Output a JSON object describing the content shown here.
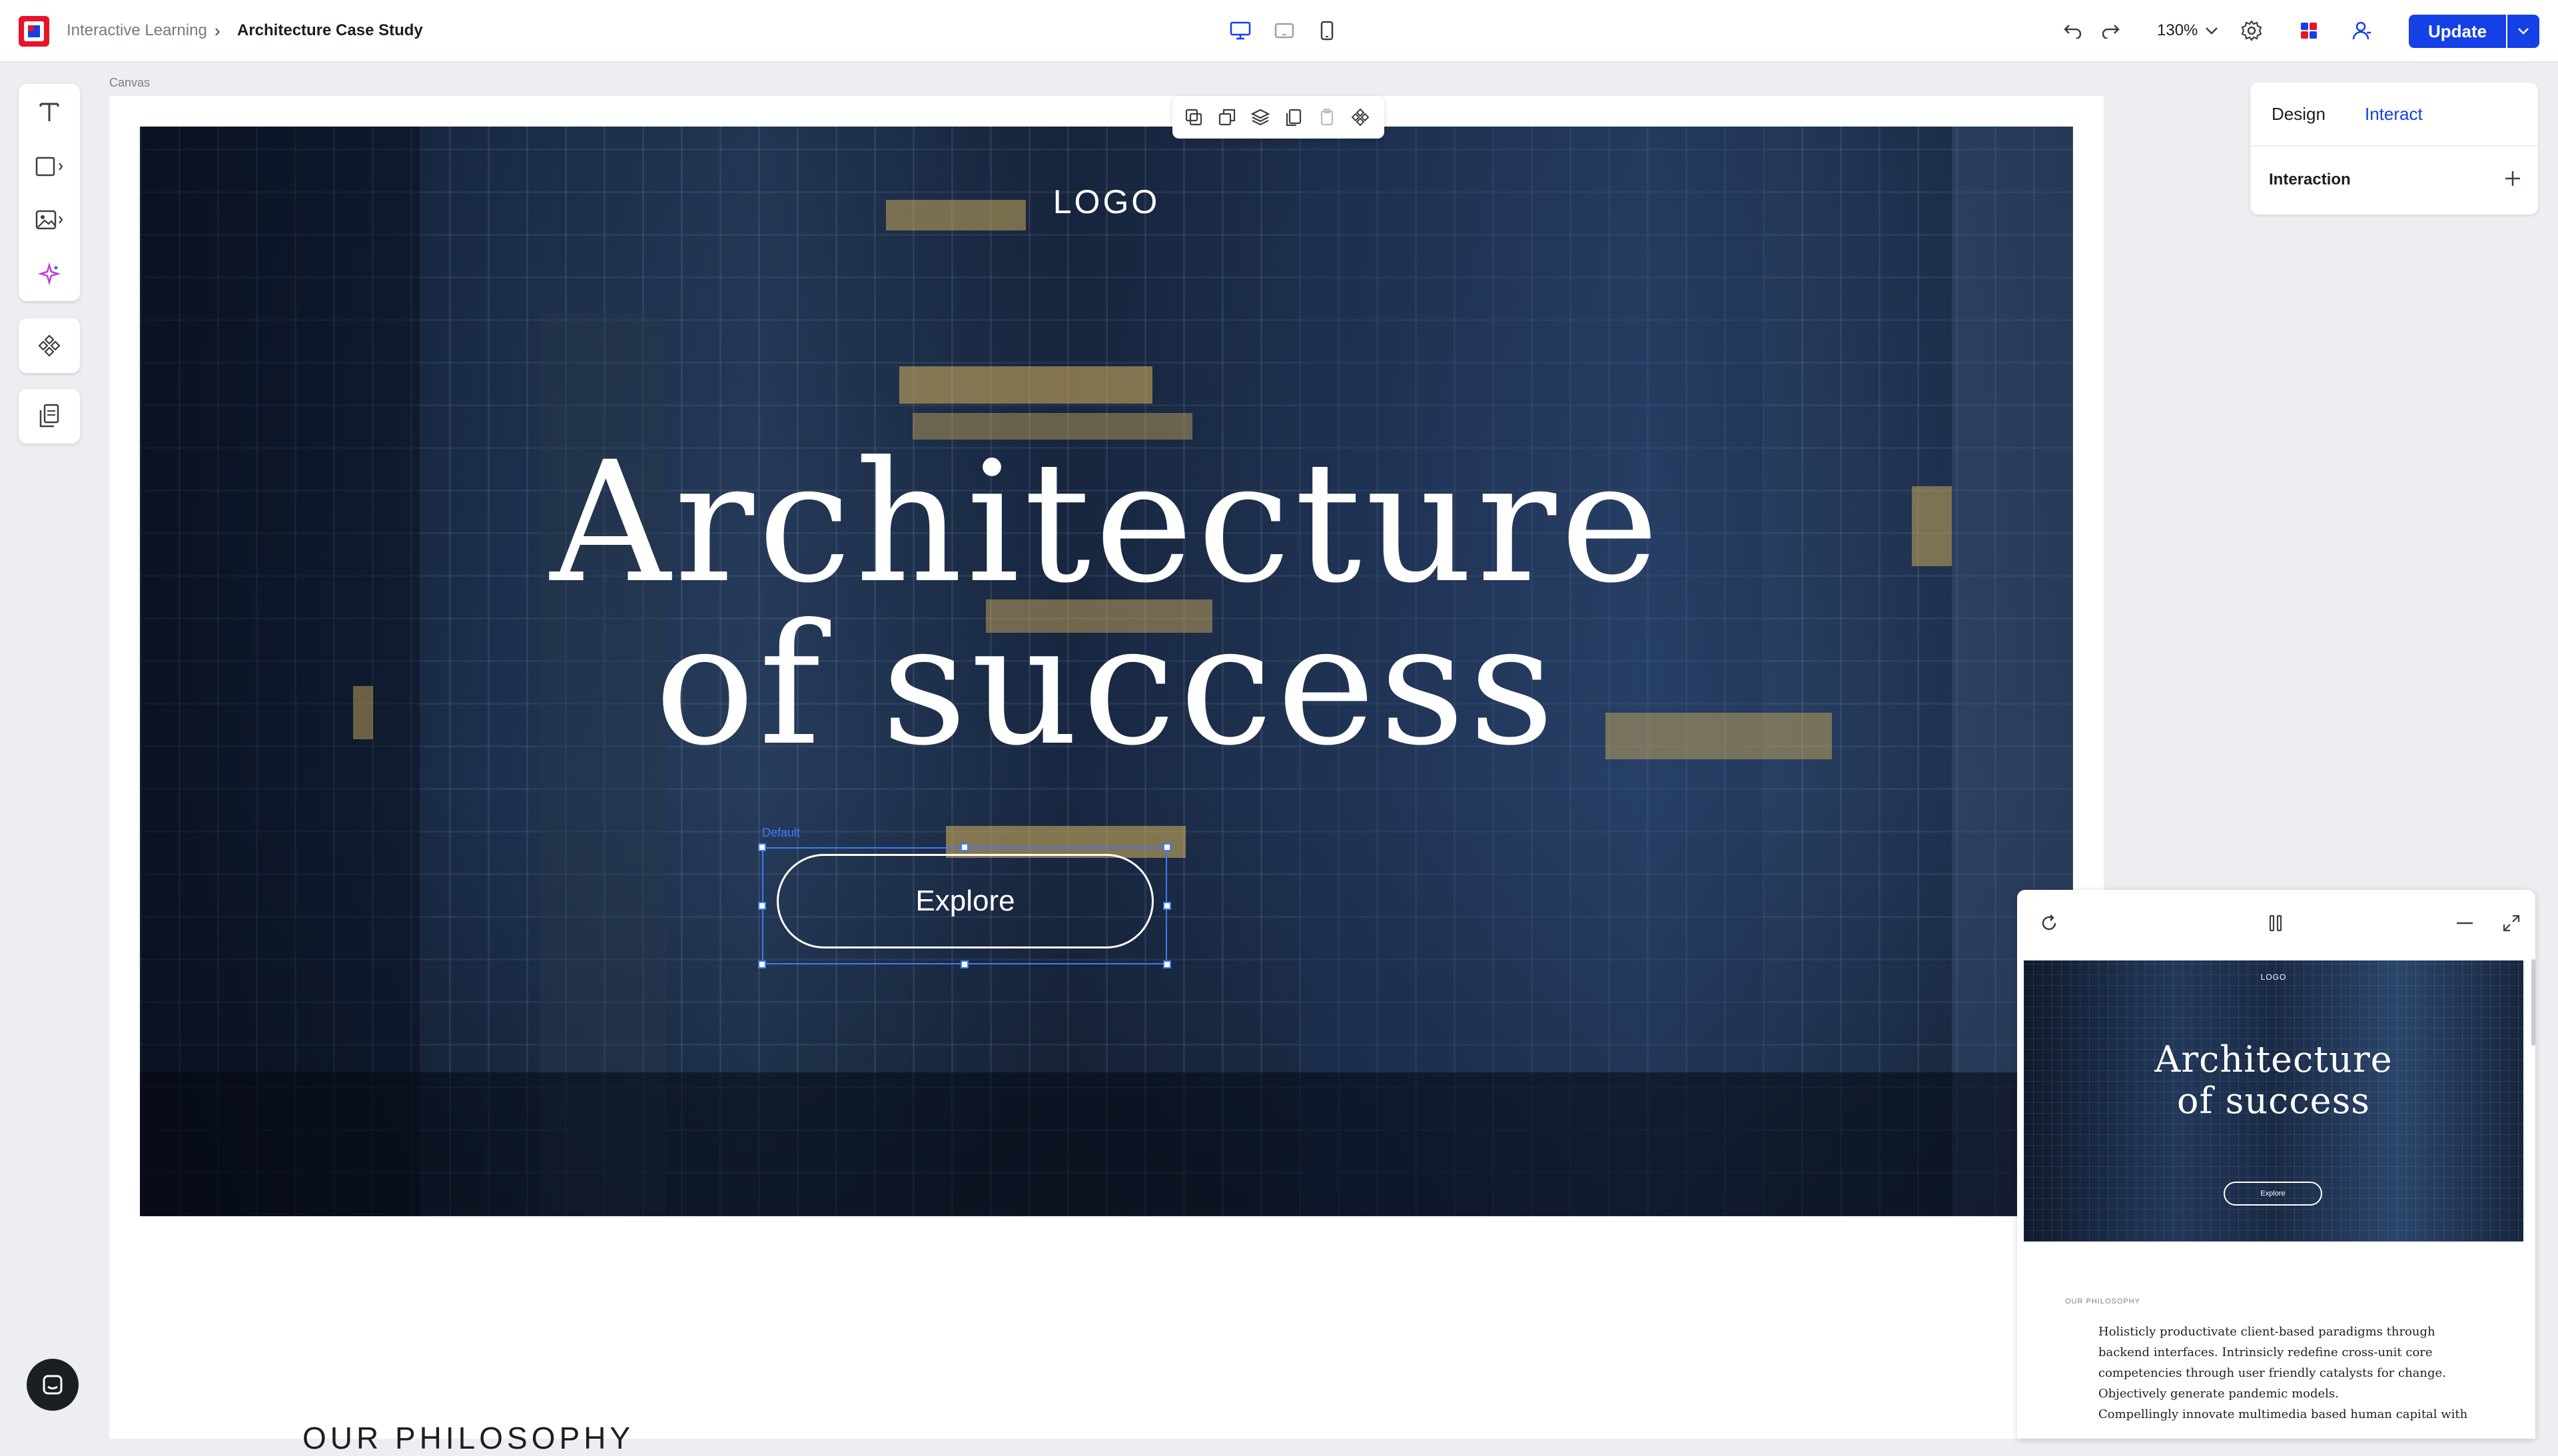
{
  "breadcrumb": {
    "parent": "Interactive Learning",
    "separator": "›",
    "current": "Architecture Case Study"
  },
  "toolbar": {
    "zoom": "130%",
    "update_label": "Update"
  },
  "canvas": {
    "label": "Canvas",
    "selection_state": "Default"
  },
  "hero": {
    "logo": "LOGO",
    "title_line1": "Architecture",
    "title_line2": "of success",
    "button": "Explore"
  },
  "section": {
    "heading": "OUR PHILOSOPHY"
  },
  "panel": {
    "tab_design": "Design",
    "tab_interact": "Interact",
    "interaction_label": "Interaction"
  },
  "preview": {
    "logo": "LOGO",
    "title_line1": "Architecture",
    "title_line2": "of success",
    "button": "Explore",
    "section_label": "OUR PHILOSOPHY",
    "para_lines": [
      "Holisticly productivate client-based paradigms through",
      "backend interfaces. Intrinsicly redefine cross-unit core",
      "competencies through user friendly catalysts for change.",
      "Objectively generate pandemic models.",
      "Compellingly innovate multimedia based human capital with"
    ]
  },
  "colors": {
    "accent": "#1440e6",
    "selection": "#3d7bff",
    "brand_red": "#e8132b"
  }
}
